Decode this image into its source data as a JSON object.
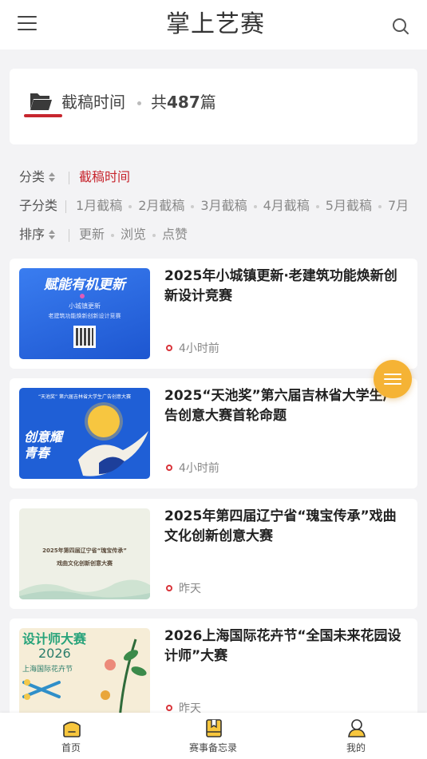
{
  "header": {
    "logo_text": "掌上艺赛",
    "menu_icon": "hamburger-menu-icon",
    "search_icon": "search-icon"
  },
  "section_header": {
    "title": "截稿时间",
    "total_prefix": "共",
    "total_count": "487",
    "total_suffix": "篇",
    "icon": "folder-open-icon",
    "accent_color": "#c7262e"
  },
  "filters": {
    "category": {
      "label": "分类",
      "active": "截稿时间"
    },
    "subcategory": {
      "label": "子分类",
      "options": [
        "1月截稿",
        "2月截稿",
        "3月截稿",
        "4月截稿",
        "5月截稿",
        "7月"
      ]
    },
    "sort": {
      "label": "排序",
      "options": [
        "更新",
        "浏览",
        "点赞"
      ]
    }
  },
  "articles": [
    {
      "title": "2025年小城镇更新·老建筑功能焕新创新设计竞赛",
      "time": "4小时前",
      "thumb": {
        "heading": "赋能有机更新",
        "line1": "小城镇更新",
        "line2": "老建筑功能焕新创新设计竞赛",
        "bg": "#2f6be0"
      }
    },
    {
      "title": "2025“天池奖”第六届吉林省大学生广告创意大赛首轮命题",
      "time": "4小时前",
      "thumb": {
        "banner": "“天池奖” 第六届吉林省大学生广告创意大赛",
        "side_text": "创意耀青春",
        "bg": "#1f5fd6"
      }
    },
    {
      "title": "2025年第四届辽宁省“瑰宝传承”戏曲文化创新创意大赛",
      "time": "昨天",
      "thumb": {
        "line1": "2025年第四届辽宁省“瑰宝传承”",
        "line2": "戏曲文化创新创意大赛",
        "bg": "#eef0e6"
      }
    },
    {
      "title": "2026上海国际花卉节“全国未来花园设计师”大赛",
      "time": "昨天",
      "thumb": {
        "heading": "设计师大赛",
        "year": "2026",
        "line1": "上海国际花卉节",
        "bg": "#f6edd7"
      }
    }
  ],
  "fab": {
    "icon": "list-menu-icon",
    "color": "#f5b335"
  },
  "bottom_nav": [
    {
      "label": "首页",
      "icon": "home-icon"
    },
    {
      "label": "赛事备忘录",
      "icon": "bookmark-book-icon"
    },
    {
      "label": "我的",
      "icon": "user-profile-icon"
    }
  ]
}
